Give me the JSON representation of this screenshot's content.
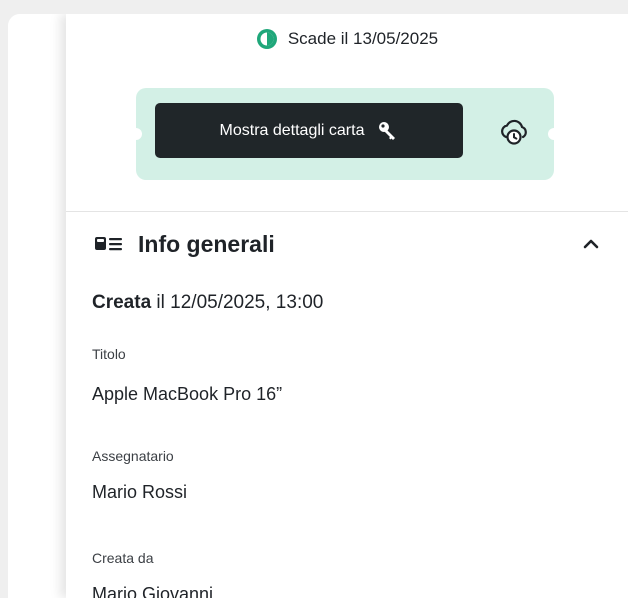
{
  "expiry": {
    "text": "Scade il 13/05/2025"
  },
  "card_actions": {
    "reveal_label": "Mostra dettagli carta"
  },
  "section": {
    "title": "Info generali"
  },
  "created": {
    "prefix": "Creata",
    "suffix": " il 12/05/2025, 13:00"
  },
  "fields": [
    {
      "label": "Titolo",
      "value": "Apple MacBook Pro 16”"
    },
    {
      "label": "Assegnatario",
      "value": "Mario Rossi"
    },
    {
      "label": "Creata da",
      "value": "Mario Giovanni"
    }
  ],
  "colors": {
    "accent": "#1fa77a",
    "ticket_bg": "#d3f0e6",
    "button_bg": "#202629"
  },
  "icons": {
    "expiry": "clock-progress-icon",
    "reveal": "key-icon",
    "cloud": "cloud-clock-icon",
    "section": "list-card-icon",
    "collapse": "chevron-up-icon"
  }
}
